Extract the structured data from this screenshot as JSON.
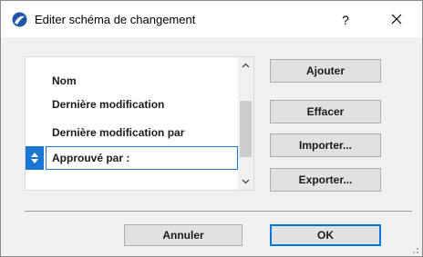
{
  "window": {
    "title": "Editer schéma de changement",
    "help_label": "?"
  },
  "list": {
    "items": [
      {
        "label": "Nom"
      },
      {
        "label": "Dernière modification"
      },
      {
        "label": "Dernière modification par"
      }
    ],
    "editing_value": "Approuvé par :"
  },
  "actions": {
    "add_label": "Ajouter",
    "delete_label": "Effacer",
    "import_label": "Importer...",
    "export_label": "Exporter..."
  },
  "footer": {
    "cancel_label": "Annuler",
    "ok_label": "OK"
  },
  "icons": {
    "app": "archicad-app-icon",
    "close": "close-icon",
    "scroll_up": "chevron-up-icon",
    "scroll_down": "chevron-down-icon",
    "drag_handle": "reorder-handle-icon"
  },
  "colors": {
    "accent": "#1976d2",
    "default_button_border": "#0078d7",
    "app_icon": "#1c57a8"
  }
}
